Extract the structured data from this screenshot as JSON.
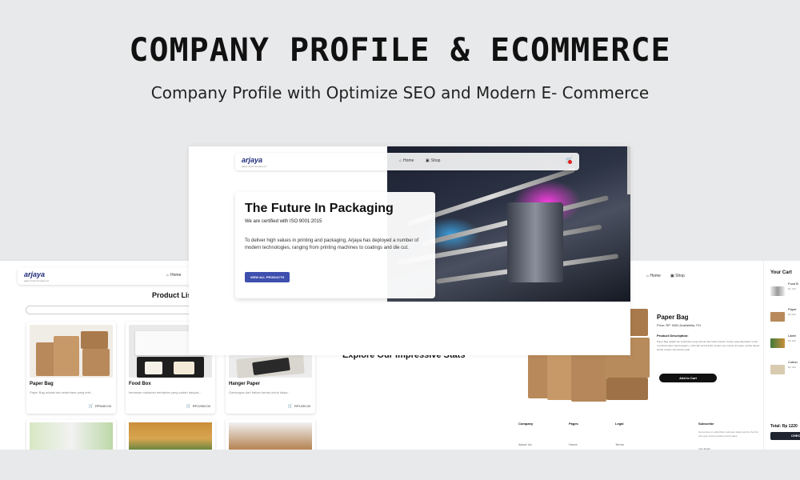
{
  "header": {
    "title": "COMPANY PROFILE  & ECOMMERCE",
    "subtitle": "Company Profile with Optimize SEO and Modern E- Commerce"
  },
  "brand": {
    "logo": "arjaya",
    "tagline": "paper food company id"
  },
  "nav": {
    "home": "Home",
    "shop": "Shop"
  },
  "hero": {
    "title": "The Future In Packaging",
    "certification": "We are certified with ISO 9001:2015",
    "description": "To deliver high values in printing and packaging, Arjaya has deployed a number of modern technologies, ranging from printing machines to coatings and die cut.",
    "cta": "VIEW ALL PRODUCTS"
  },
  "stats": {
    "heading": "Explore Our Impressive Stats"
  },
  "product_list": {
    "title": "Product List",
    "items": [
      {
        "name": "Paper Bag",
        "desc": "Paper Bag adalah tas sederhana yang terb...",
        "price": "RP5400.00"
      },
      {
        "name": "Food Box",
        "desc": "kemasan makanan berbahan yang sudah banyak...",
        "price": "RP12000.00"
      },
      {
        "name": "Hanger Paper",
        "desc": "Gantungan dari bahan kertas untuk dispa...",
        "price": "RP1200.00"
      }
    ]
  },
  "detail": {
    "name": "Paper Bag",
    "price_line": "Price: RP. 5400    Availability: PO",
    "desc_head": "Product Description:",
    "desc": "Paper Bag adalah tas sederhana yang terbuat dari bahan kertas. Kertas yang digunakan untuk membuat paper bag beragam, mulai dari kertas kraft, kertas ivory, kertas art paper, kertas duplex, kertas coated, dan kertas padu.",
    "add_to_cart": "Add to Cart"
  },
  "footer": {
    "company": "Company",
    "pages": "Pages",
    "legal": "Legal",
    "about": "About Us",
    "home": "Home",
    "terms": "Terms",
    "subscribe": "Subscribe",
    "subscribe_text": "Get access to subscriber exclusive deals and be the first who gets informed about fresh sales.",
    "email_placeholder": "Your Email"
  },
  "cart": {
    "title": "Your Cart",
    "items": [
      {
        "name": "Food B",
        "price": "Rp 120"
      },
      {
        "name": "Paper",
        "price": "Rp 540"
      },
      {
        "name": "Label",
        "price": "Rp 100"
      },
      {
        "name": "Cotton",
        "price": "Rp 100"
      }
    ],
    "total": "Total: Rp 1220",
    "checkout": "CHECKOUT"
  },
  "colors": {
    "background": "#e8e9ea",
    "primary_button": "#3e4fae",
    "brand_blue": "#1d2a78",
    "hero_accent": "#ff3ce6"
  }
}
